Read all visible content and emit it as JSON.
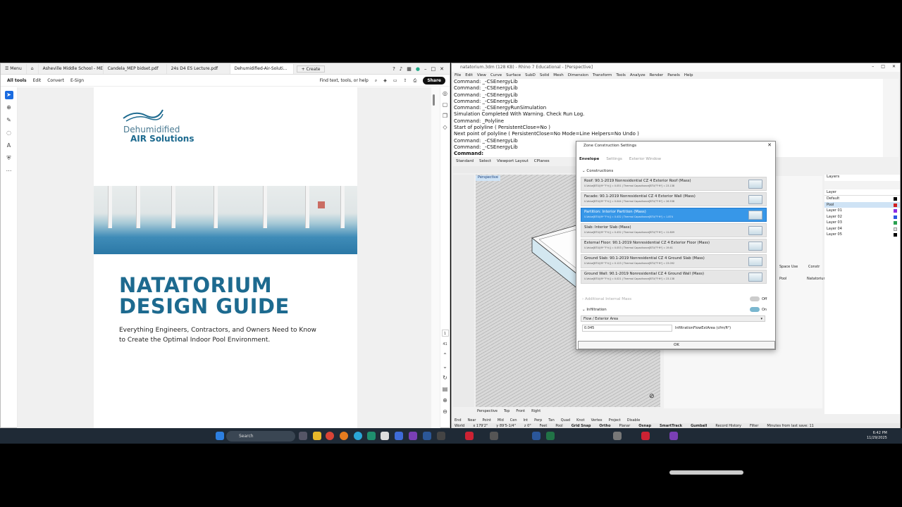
{
  "acrobat": {
    "menu": "Menu",
    "tabs": [
      "Asheville Middle School - MEP...",
      "Candela_MEP bidset.pdf",
      "24s D4 ES Lecture.pdf",
      "Dehumidified-Air-Soluti...",
      "Create"
    ],
    "toolbar": [
      "All tools",
      "Edit",
      "Convert",
      "E-Sign"
    ],
    "find": "Find text, tools, or help",
    "share": "Share",
    "page_num": "1",
    "page_total": "41",
    "logo_line1": "Dehumidified",
    "logo_line2": "AIR Solutions",
    "title1": "NATATORIUM",
    "title2": "DESIGN GUIDE",
    "subtitle": "Everything Engineers, Contractors, and Owners Need to Know to Create the Optimal Indoor Pool Environment."
  },
  "rhino": {
    "title": "natatorium.3dm (128 KB) - Rhino 7 Educational - [Perspective]",
    "menu": [
      "File",
      "Edit",
      "View",
      "Curve",
      "Surface",
      "SubD",
      "Solid",
      "Mesh",
      "Dimension",
      "Transform",
      "Tools",
      "Analyze",
      "Render",
      "Panels",
      "Help"
    ],
    "command_lines": [
      "Command: _-CSEnergyLib",
      "Command: _-CSEnergyLib",
      "Command: _-CSEnergyLib",
      "Command: _-CSEnergyLib",
      "Command: _-CSEnergyRunSimulation",
      "Simulation Completed With Warning. Check Run Log.",
      "Command: _Polyline",
      "Start of polyline ( PersistentClose=No )",
      "Next point of polyline ( PersistentClose=No  Mode=Line  Helpers=No  Undo )",
      "Command: _-CSEnergyLib",
      "Command: _-CSEnergyLib"
    ],
    "command_prompt": "Command:",
    "vp_tabs": [
      "Standard",
      "Select",
      "Viewport Layout",
      "CPlanes"
    ],
    "viewport_label": "Perspective",
    "bottom_tabs": [
      "Perspective",
      "Top",
      "Front",
      "Right"
    ],
    "osnaps": [
      "End",
      "Near",
      "Point",
      "Mid",
      "Cen",
      "Int",
      "Perp",
      "Tan",
      "Quad",
      "Knot",
      "Vertex",
      "Project",
      "Disable"
    ],
    "status": [
      "World",
      "x 179'2\"",
      "y 89'5-1/4\"",
      "z 0\"",
      "Feet",
      "Pool",
      "Grid Snap",
      "Ortho",
      "Planar",
      "Osnap",
      "SmartTrack",
      "Gumball",
      "Record History",
      "Filter",
      "Minutes from last save: 11"
    ],
    "layers_title": "Layers",
    "layers_header": "Layer",
    "layers": [
      "Default",
      "Pool",
      "Layer 01",
      "Layer 02",
      "Layer 03",
      "Layer 04",
      "Layer 05"
    ],
    "layer_colors": [
      "#000000",
      "#d02020",
      "#8a2be2",
      "#2a55e0",
      "#2aa050",
      "#e2e2e2",
      "#000000"
    ],
    "panel_space_use": "Space Use",
    "panel_constr": "Constr",
    "panel_pool": "Pool",
    "panel_natatorium": "Natatorium"
  },
  "dialog": {
    "title": "Zone Construction Settings",
    "tabs": [
      "Envelope",
      "Settings",
      "Exterior Window"
    ],
    "section": "Constructions",
    "constructions": [
      {
        "name": "Roof: 90.1-2019 Nonresidential CZ 4 Exterior Roof (Mass)",
        "detail": "U-Value[BTU/(ft²·°F·h)] = 0.051  |  Thermal Capacitance[BTU/°F·ft²] = 23.138"
      },
      {
        "name": "Facade: 90.1-2019 Nonresidential CZ 4 Exterior Wall (Mass)",
        "detail": "U-Value[BTU/(ft²·°F·h)] = 0.044  |  Thermal Capacitance[BTU/°F·ft²] = 26.538"
      },
      {
        "name": "Partition: Interior Partition (Mass)",
        "detail": "U-Value[BTU/(ft²·°F·h)] = 0.432  |  Thermal Capacitance[BTU/°F·ft²] = 1.874"
      },
      {
        "name": "Slab: Interior Slab (Mass)",
        "detail": "U-Value[BTU/(ft²·°F·h)] = 0.432  |  Thermal Capacitance[BTU/°F·ft²] = 11.809"
      },
      {
        "name": "External Floor: 90.1-2019 Nonresidential CZ 4 Exterior Floor (Mass)",
        "detail": "U-Value[BTU/(ft²·°F·h)] = 0.053  |  Thermal Capacitance[BTU/°F·ft²] = 19.61"
      },
      {
        "name": "Ground Slab: 90.1-2019 Nonresidential CZ 4 Ground Slab (Mass)",
        "detail": "U-Value[BTU/(ft²·°F·h)] = 0.123  |  Thermal Capacitance[BTU/°F·ft²] = 23.092"
      },
      {
        "name": "Ground Wall: 90.1-2019 Nonresidential CZ 4 Ground Wall (Mass)",
        "detail": "U-Value[BTU/(ft²·°F·h)] = 0.021  |  Thermal Capacitance[BTU/°F·ft²] = 23.138"
      }
    ],
    "selected_index": 2,
    "internal_mass": "Additional Internal Mass",
    "internal_mass_state": "Off",
    "infiltration": "Infiltration",
    "infiltration_state": "On",
    "flow_select": "Flow / Exterior Area",
    "flow_value": "0.045",
    "flow_label": "InfiltrationFlowExtArea (cfm/ft²)",
    "ok": "OK"
  },
  "taskbar": {
    "search": "Search",
    "time": "6:42 PM",
    "date": "11/29/2025"
  }
}
